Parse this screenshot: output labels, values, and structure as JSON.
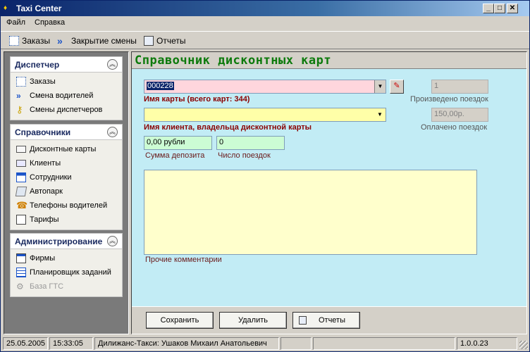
{
  "window": {
    "title": "Taxi Center",
    "min": "_",
    "max": "□",
    "close": "✕"
  },
  "menu": {
    "file": "Файл",
    "help": "Справка"
  },
  "toolbar": {
    "orders": "Заказы",
    "close_shift": "Закрытие смены",
    "reports": "Отчеты"
  },
  "sidebar": {
    "dispatcher": {
      "title": "Диспетчер",
      "items": [
        "Заказы",
        "Смена водителей",
        "Смены диспетчеров"
      ]
    },
    "references": {
      "title": "Справочники",
      "items": [
        "Дисконтные карты",
        "Клиенты",
        "Сотрудники",
        "Автопарк",
        "Телефоны водителей",
        "Тарифы"
      ]
    },
    "admin": {
      "title": "Администрирование",
      "items": [
        "Фирмы",
        "Планировщик заданий",
        "База ГТС"
      ]
    }
  },
  "form": {
    "title": "Справочник дисконтных карт",
    "card_value": "000228",
    "card_label": "Имя карты (всего карт: 344)",
    "client_value": "",
    "client_label": "Имя клиента, владельца дисконтной карты",
    "deposit_value": "0,00 рубли",
    "deposit_label": "Сумма депозита",
    "trips_value": "0",
    "trips_label": "Число поездок",
    "made_value": "1",
    "made_label": "Произведено поездок",
    "paid_value": "150,00р.",
    "paid_label": "Оплачено поездок",
    "comments_value": "",
    "comments_label": "Прочие комментарии"
  },
  "buttons": {
    "save": "Сохранить",
    "delete": "Удалить",
    "reports": "Отчеты"
  },
  "status": {
    "date": "25.05.2005",
    "time": "15:33:05",
    "user": "Дилижанс-Такси: Ушаков Михаил Анатольевич",
    "empty1": "",
    "empty2": "",
    "version": "1.0.0.23"
  }
}
